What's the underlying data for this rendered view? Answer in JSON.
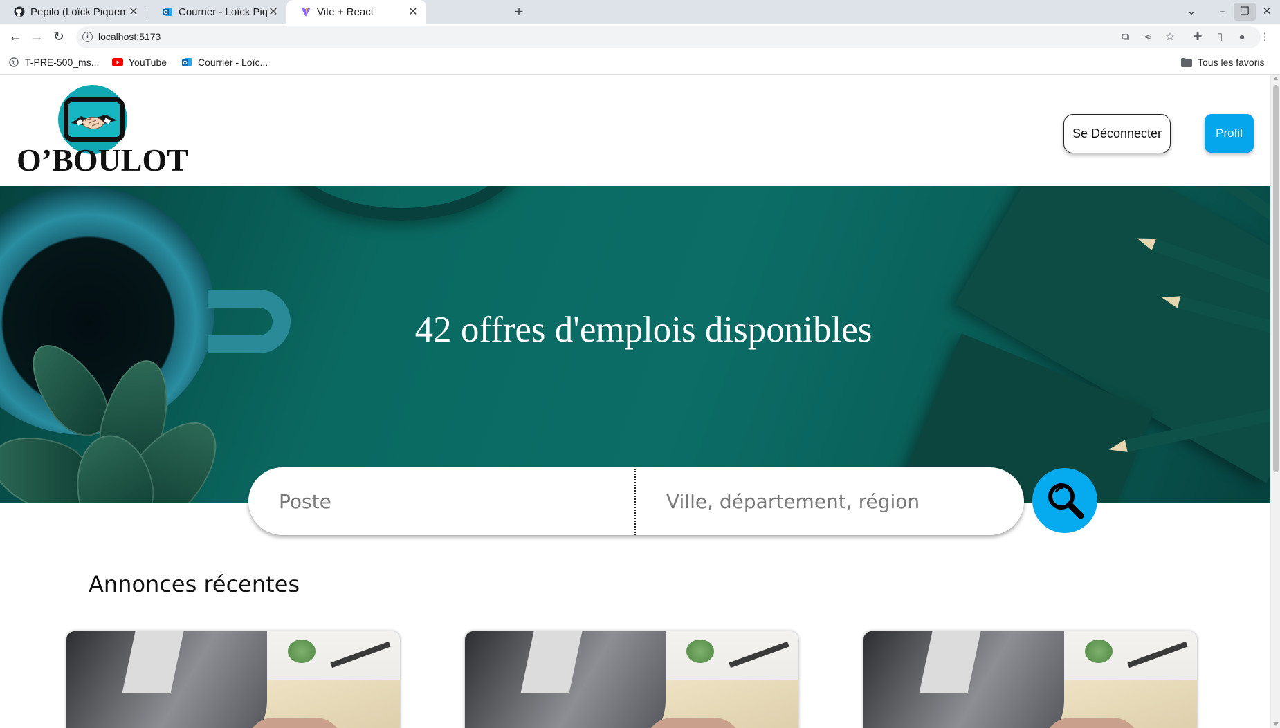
{
  "browser": {
    "tabs": [
      {
        "title": "Pepilo (Loïck Piquemal-P",
        "icon": "github-icon",
        "active": false
      },
      {
        "title": "Courrier - Loïck Piquemal",
        "icon": "outlook-icon",
        "active": false
      },
      {
        "title": "Vite + React",
        "icon": "vite-icon",
        "active": true
      }
    ],
    "url": "localhost:5173",
    "bookmarks": [
      {
        "label": "T-PRE-500_ms...",
        "icon": "globe-icon"
      },
      {
        "label": "YouTube",
        "icon": "youtube-icon"
      },
      {
        "label": "Courrier - Loïc...",
        "icon": "outlook-icon"
      }
    ],
    "all_bookmarks_label": "Tous les favoris"
  },
  "header": {
    "logo_text": "O’BOULOT",
    "logout_label": "Se Déconnecter",
    "profile_label": "Profil"
  },
  "hero": {
    "title": "42 offres d'emplois disponibles"
  },
  "search": {
    "job_placeholder": "Poste",
    "location_placeholder": "Ville, département, région",
    "button_icon": "magnifier-icon"
  },
  "recent": {
    "title": "Annonces récentes",
    "cards_count": 3
  },
  "colors": {
    "accent": "#05a6eb",
    "hero_teal": "#0b6d66",
    "logo_teal": "#0fa8b3"
  }
}
